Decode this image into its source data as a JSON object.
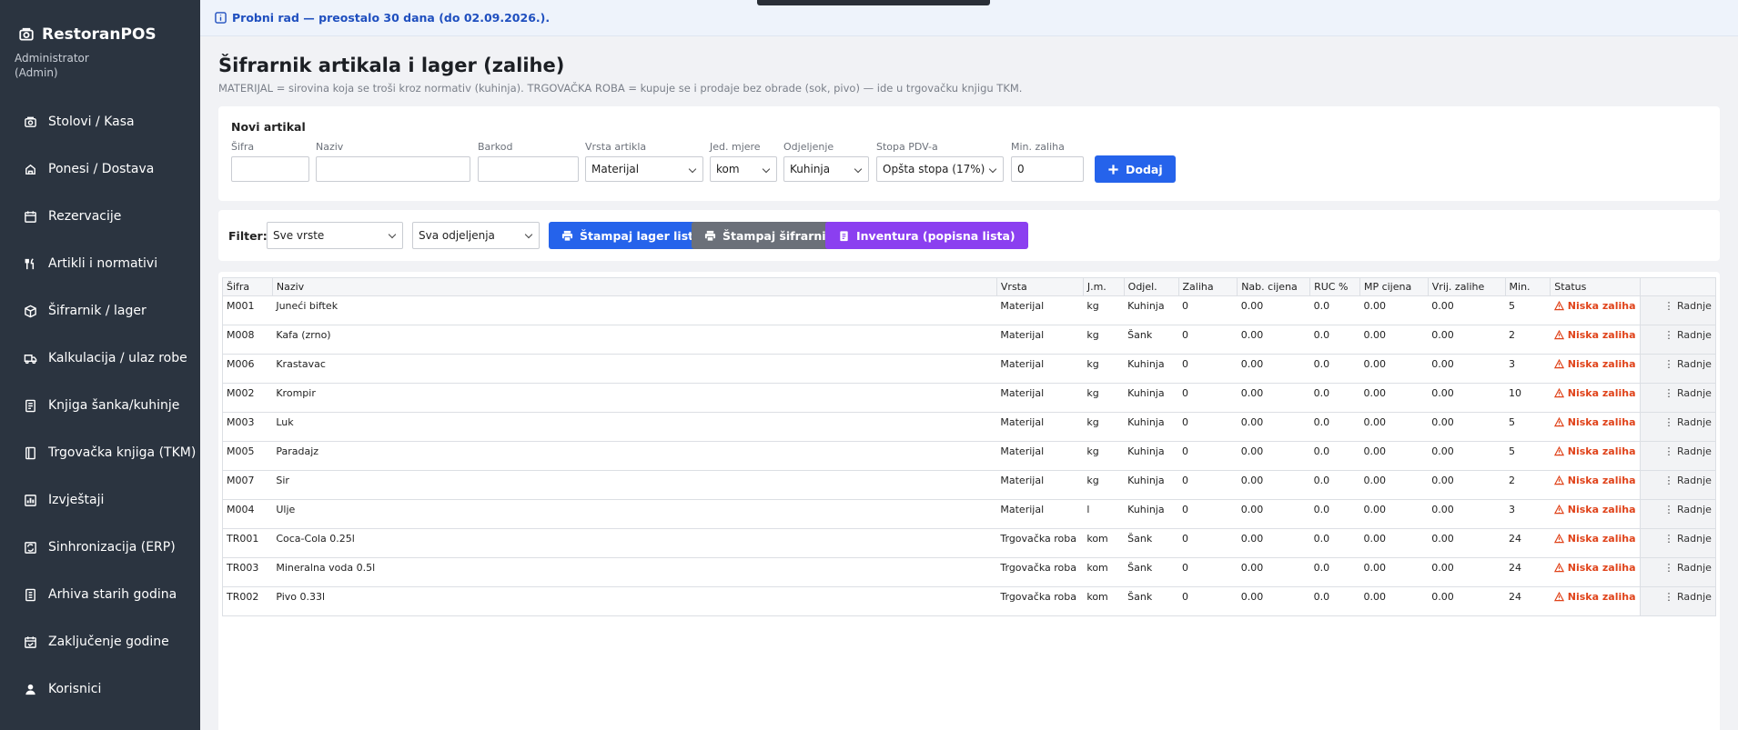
{
  "app": {
    "name": "RestoranPOS",
    "user_name": "Administrator",
    "user_role": "(Admin)"
  },
  "sidebar": {
    "items": [
      {
        "label": "Stolovi / Kasa",
        "icon": "cash-register-icon"
      },
      {
        "label": "Ponesi / Dostava",
        "icon": "delivery-icon"
      },
      {
        "label": "Rezervacije",
        "icon": "calendar-icon"
      },
      {
        "label": "Artikli i normativi",
        "icon": "utensils-icon"
      },
      {
        "label": "Šifrarnik / lager",
        "icon": "box-icon"
      },
      {
        "label": "Kalkulacija / ulaz robe",
        "icon": "truck-icon"
      },
      {
        "label": "Knjiga šanka/kuhinje",
        "icon": "book-icon"
      },
      {
        "label": "Trgovačka knjiga (TKM)",
        "icon": "ledger-icon"
      },
      {
        "label": "Izvještaji",
        "icon": "chart-icon"
      },
      {
        "label": "Sinhronizacija (ERP)",
        "icon": "sync-icon"
      },
      {
        "label": "Arhiva starih godina",
        "icon": "archive-icon"
      },
      {
        "label": "Zaključenje godine",
        "icon": "calendar-check-icon"
      },
      {
        "label": "Korisnici",
        "icon": "user-icon"
      }
    ]
  },
  "banner": {
    "text": "Probni rad — preostalo 30 dana (do 02.09.2026.)."
  },
  "page": {
    "title": "Šifrarnik artikala i lager (zalihe)",
    "subtitle": "MATERIJAL = sirovina koja se troši kroz normativ (kuhinja). TRGOVAČKA ROBA = kupuje se i prodaje bez obrade (sok, pivo) — ide u trgovačku knjigu TKM."
  },
  "new_item": {
    "heading": "Novi artikal",
    "sifra_label": "Šifra",
    "sifra_value": "",
    "naziv_label": "Naziv",
    "naziv_value": "",
    "barkod_label": "Barkod",
    "barkod_value": "",
    "vrsta_label": "Vrsta artikla",
    "vrsta_value": "Materijal",
    "jm_label": "Jed. mjere",
    "jm_value": "kom",
    "odjeljenje_label": "Odjeljenje",
    "odjeljenje_value": "Kuhinja",
    "pdv_label": "Stopa PDV-a",
    "pdv_value": "Opšta stopa (17%)",
    "min_label": "Min. zaliha",
    "min_value": "0",
    "add_button": "Dodaj"
  },
  "filter": {
    "label": "Filter:",
    "vrsta_value": "Sve vrste",
    "odjeljenje_value": "Sva odjeljenja",
    "print_lager": "Štampaj lager listu",
    "print_sifrarnik": "Štampaj šifrarnik",
    "inventura": "Inventura (popisna lista)"
  },
  "table": {
    "columns": [
      "Šifra",
      "Naziv",
      "Vrsta",
      "J.m.",
      "Odjel.",
      "Zaliha",
      "Nab. cijena",
      "RUC %",
      "MP cijena",
      "Vrij. zalihe",
      "Min.",
      "Status",
      ""
    ],
    "action_label": "⋮ Radnje",
    "rows": [
      {
        "sifra": "M001",
        "naziv": "Juneći biftek",
        "vrsta": "Materijal",
        "jm": "kg",
        "odjel": "Kuhinja",
        "zaliha": "0",
        "nab": "0.00",
        "ruc": "0.0",
        "mp": "0.00",
        "vrij": "0.00",
        "min": "5",
        "status": "Niska zaliha"
      },
      {
        "sifra": "M008",
        "naziv": "Kafa (zrno)",
        "vrsta": "Materijal",
        "jm": "kg",
        "odjel": "Šank",
        "zaliha": "0",
        "nab": "0.00",
        "ruc": "0.0",
        "mp": "0.00",
        "vrij": "0.00",
        "min": "2",
        "status": "Niska zaliha"
      },
      {
        "sifra": "M006",
        "naziv": "Krastavac",
        "vrsta": "Materijal",
        "jm": "kg",
        "odjel": "Kuhinja",
        "zaliha": "0",
        "nab": "0.00",
        "ruc": "0.0",
        "mp": "0.00",
        "vrij": "0.00",
        "min": "3",
        "status": "Niska zaliha"
      },
      {
        "sifra": "M002",
        "naziv": "Krompir",
        "vrsta": "Materijal",
        "jm": "kg",
        "odjel": "Kuhinja",
        "zaliha": "0",
        "nab": "0.00",
        "ruc": "0.0",
        "mp": "0.00",
        "vrij": "0.00",
        "min": "10",
        "status": "Niska zaliha"
      },
      {
        "sifra": "M003",
        "naziv": "Luk",
        "vrsta": "Materijal",
        "jm": "kg",
        "odjel": "Kuhinja",
        "zaliha": "0",
        "nab": "0.00",
        "ruc": "0.0",
        "mp": "0.00",
        "vrij": "0.00",
        "min": "5",
        "status": "Niska zaliha"
      },
      {
        "sifra": "M005",
        "naziv": "Paradajz",
        "vrsta": "Materijal",
        "jm": "kg",
        "odjel": "Kuhinja",
        "zaliha": "0",
        "nab": "0.00",
        "ruc": "0.0",
        "mp": "0.00",
        "vrij": "0.00",
        "min": "5",
        "status": "Niska zaliha"
      },
      {
        "sifra": "M007",
        "naziv": "Sir",
        "vrsta": "Materijal",
        "jm": "kg",
        "odjel": "Kuhinja",
        "zaliha": "0",
        "nab": "0.00",
        "ruc": "0.0",
        "mp": "0.00",
        "vrij": "0.00",
        "min": "2",
        "status": "Niska zaliha"
      },
      {
        "sifra": "M004",
        "naziv": "Ulje",
        "vrsta": "Materijal",
        "jm": "l",
        "odjel": "Kuhinja",
        "zaliha": "0",
        "nab": "0.00",
        "ruc": "0.0",
        "mp": "0.00",
        "vrij": "0.00",
        "min": "3",
        "status": "Niska zaliha"
      },
      {
        "sifra": "TR001",
        "naziv": "Coca-Cola 0.25l",
        "vrsta": "Trgovačka roba",
        "jm": "kom",
        "odjel": "Šank",
        "zaliha": "0",
        "nab": "0.00",
        "ruc": "0.0",
        "mp": "0.00",
        "vrij": "0.00",
        "min": "24",
        "status": "Niska zaliha"
      },
      {
        "sifra": "TR003",
        "naziv": "Mineralna voda 0.5l",
        "vrsta": "Trgovačka roba",
        "jm": "kom",
        "odjel": "Šank",
        "zaliha": "0",
        "nab": "0.00",
        "ruc": "0.0",
        "mp": "0.00",
        "vrij": "0.00",
        "min": "24",
        "status": "Niska zaliha"
      },
      {
        "sifra": "TR002",
        "naziv": "Pivo 0.33l",
        "vrsta": "Trgovačka roba",
        "jm": "kom",
        "odjel": "Šank",
        "zaliha": "0",
        "nab": "0.00",
        "ruc": "0.0",
        "mp": "0.00",
        "vrij": "0.00",
        "min": "24",
        "status": "Niska zaliha"
      }
    ]
  },
  "colors": {
    "sidebar": "#2b3440",
    "primary": "#2563eb",
    "secondary": "#6b7079",
    "accent": "#8b3ff0",
    "warning": "#e0431a"
  }
}
